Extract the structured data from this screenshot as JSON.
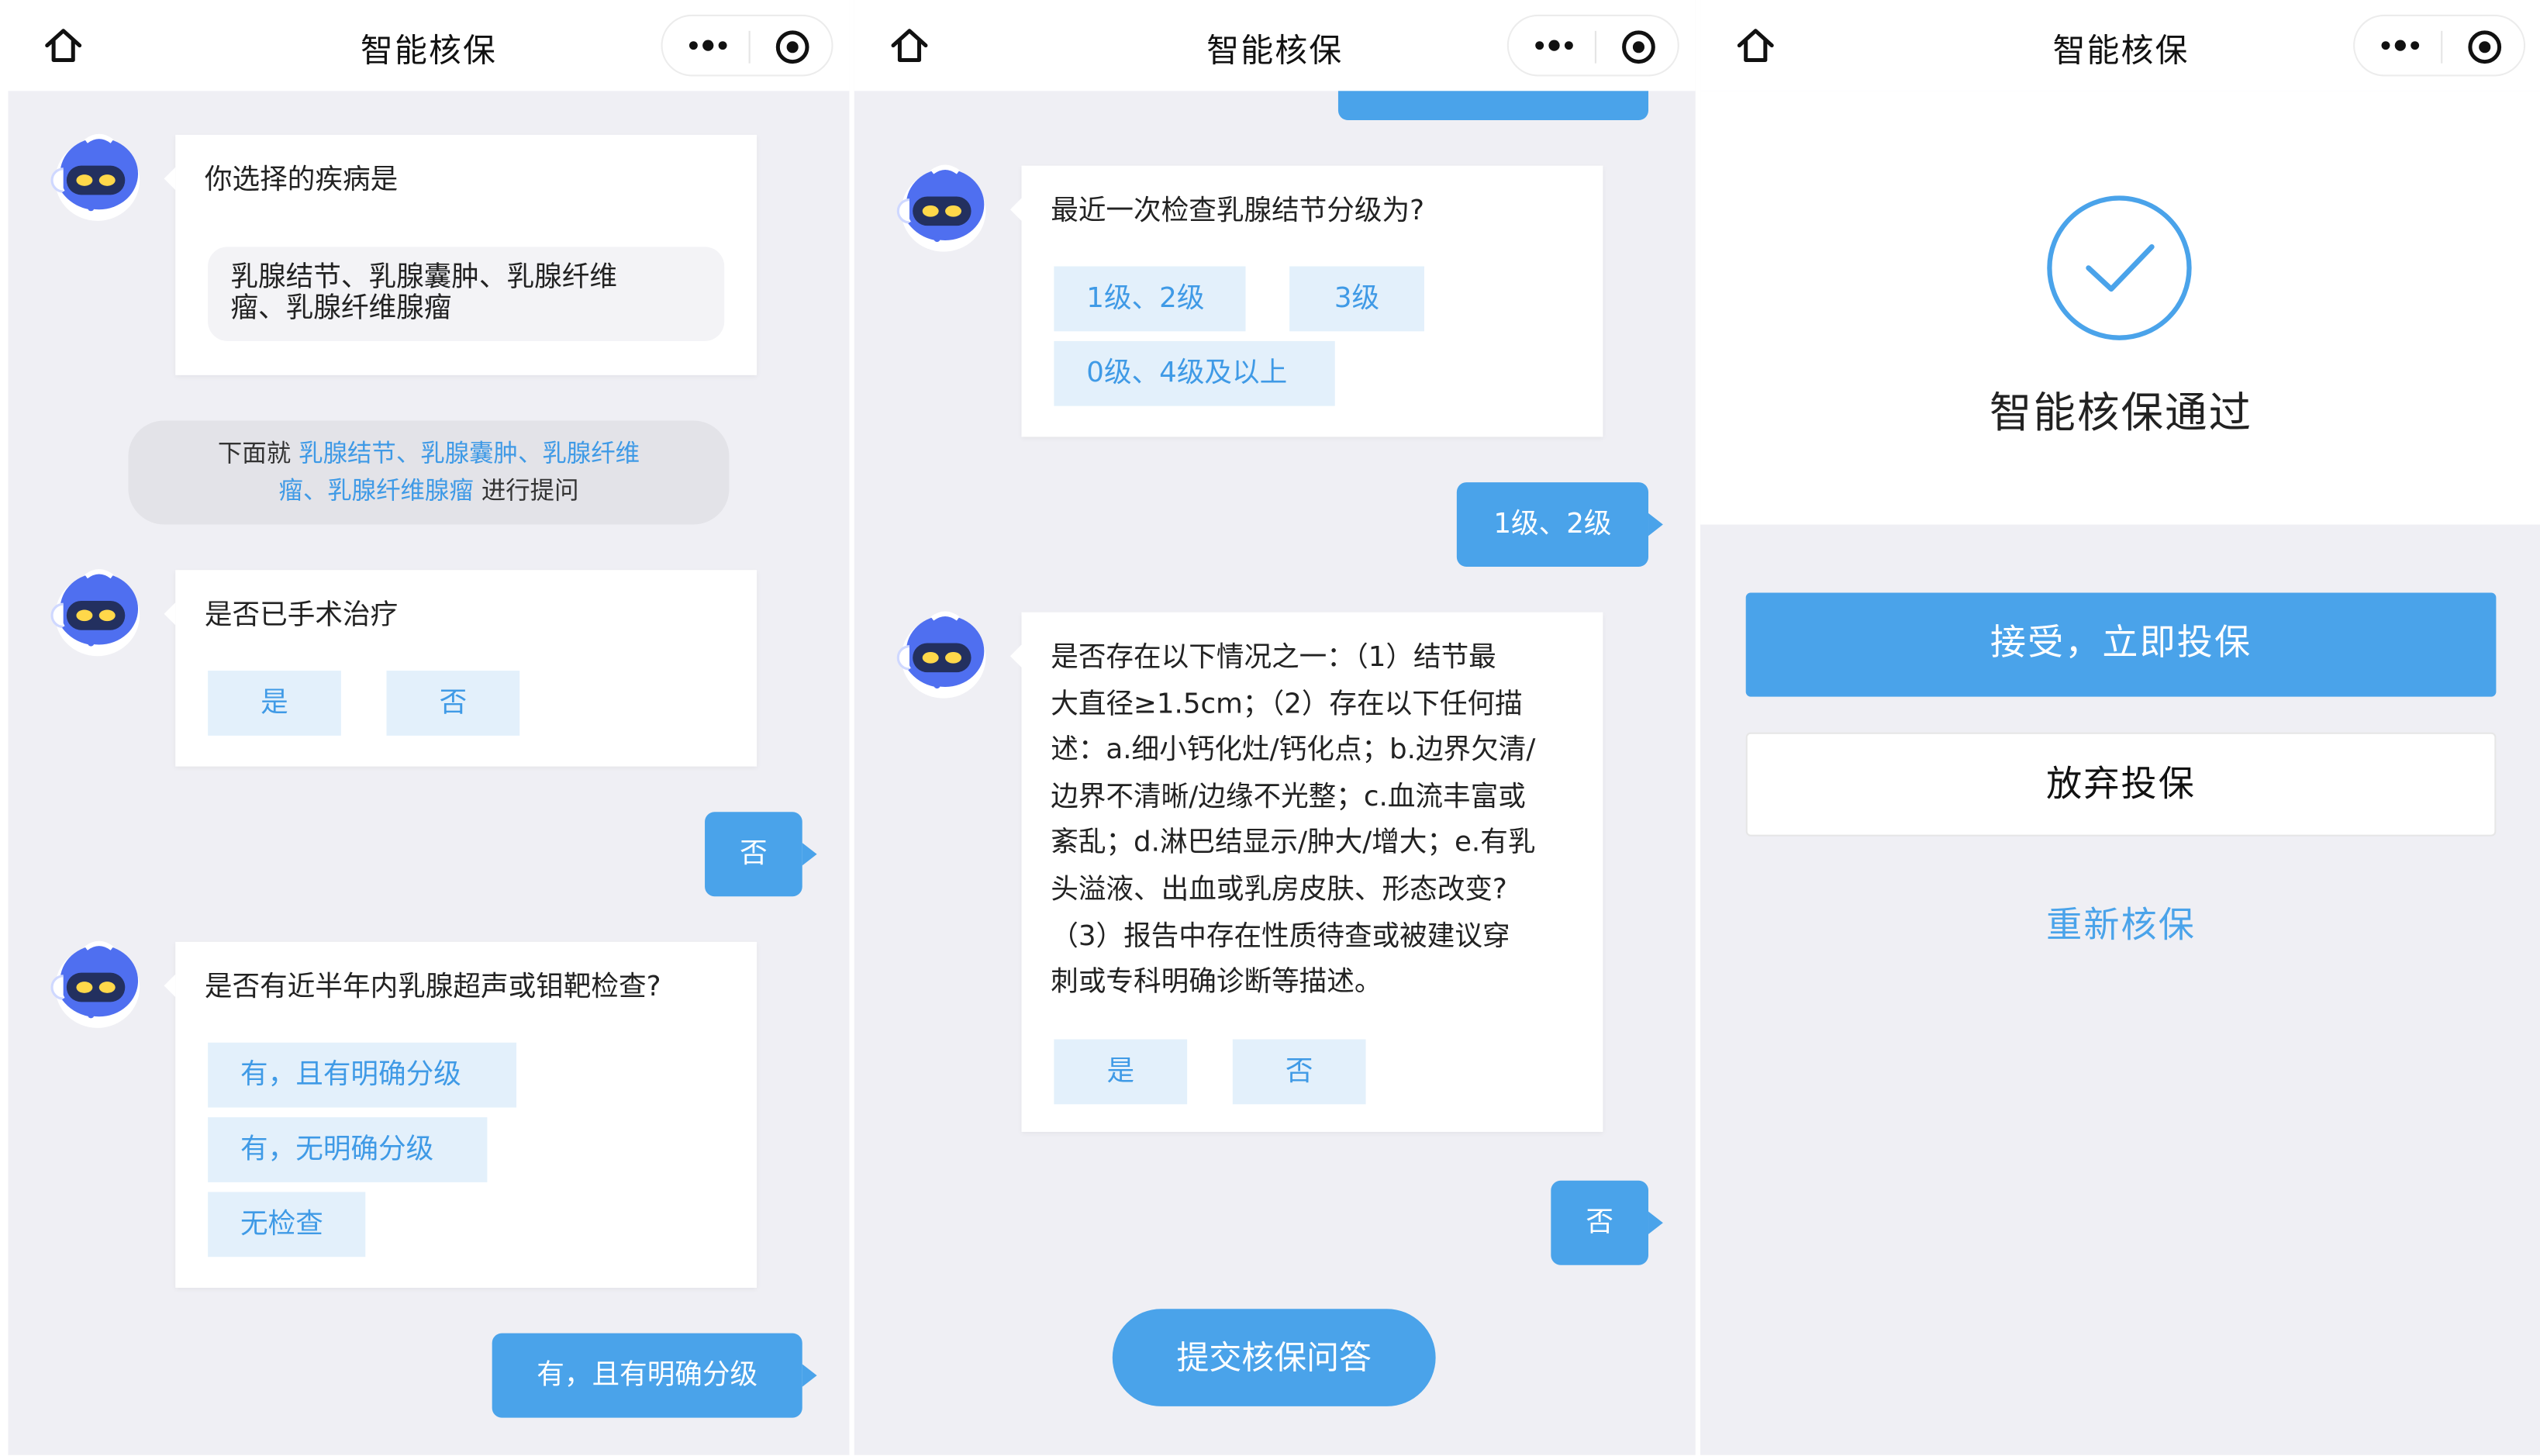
{
  "colors": {
    "accent": "#4aa3ea",
    "chip_bg": "#e3f0fb",
    "chip_text": "#3f9ae6",
    "chat_bg": "#efeff4"
  },
  "icons": {
    "nav_home": "home-icon",
    "nav_more": "more-dots-icon",
    "nav_close": "target-circle-icon",
    "bot": "robot-avatar-icon",
    "success": "check-circle-icon"
  },
  "navbar": {
    "title": "智能核保"
  },
  "panel1": {
    "q_disease": {
      "text": "你选择的疾病是",
      "selected_line1": "乳腺结节、乳腺囊肿、乳腺纤维",
      "selected_line2": "瘤、乳腺纤维腺瘤"
    },
    "notice": {
      "prefix": "下面就",
      "diseases_line1": "乳腺结节、乳腺囊肿、乳腺纤维",
      "diseases_line2": "瘤、乳腺纤维腺瘤",
      "suffix": "进行提问"
    },
    "q_surgery": {
      "text": "是否已手术治疗",
      "options": [
        "是",
        "否"
      ]
    },
    "reply_surgery": "否",
    "q_exam": {
      "text": "是否有近半年内乳腺超声或钼靶检查?",
      "options": [
        "有，且有明确分级",
        "有，无明确分级",
        "无检查"
      ]
    },
    "reply_exam": "有，且有明确分级"
  },
  "panel2": {
    "q_grade": {
      "text": "最近一次检查乳腺结节分级为?",
      "options": [
        "1级、2级",
        "3级",
        "0级、4级及以上"
      ]
    },
    "reply_grade": "1级、2级",
    "q_conditions": {
      "lines": [
        "是否存在以下情况之一：（1）结节最",
        "大直径≥1.5cm；（2）存在以下任何描",
        "述：a.细小钙化灶/钙化点；b.边界欠清/",
        "边界不清晰/边缘不光整；c.血流丰富或",
        "紊乱；d.淋巴结显示/肿大/增大；e.有乳",
        "头溢液、出血或乳房皮肤、形态改变?",
        "（3）报告中存在性质待查或被建议穿",
        "刺或专科明确诊断等描述。"
      ],
      "options": [
        "是",
        "否"
      ]
    },
    "reply_conditions": "否",
    "submit_label": "提交核保问答"
  },
  "panel3": {
    "result_text": "智能核保通过",
    "accept_label": "接受，立即投保",
    "abandon_label": "放弃投保",
    "redo_label": "重新核保"
  }
}
